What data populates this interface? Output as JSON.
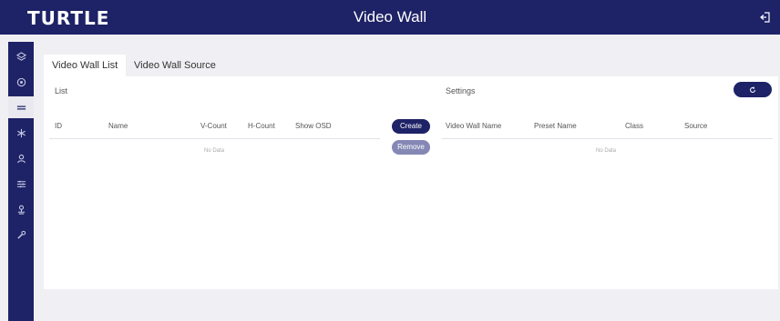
{
  "header": {
    "logo": "TURTLE",
    "title": "Video Wall"
  },
  "sidebar": {
    "items": [
      {
        "icon": "stack-icon"
      },
      {
        "icon": "target-icon"
      },
      {
        "icon": "grid-icon",
        "active": true
      },
      {
        "icon": "network-icon"
      },
      {
        "icon": "user-icon"
      },
      {
        "icon": "sliders-icon"
      },
      {
        "icon": "admin-icon"
      },
      {
        "icon": "wrench-icon"
      }
    ]
  },
  "tabs": [
    {
      "label": "Video Wall List",
      "active": true
    },
    {
      "label": "Video Wall Source",
      "active": false
    }
  ],
  "list": {
    "label": "List",
    "columns": [
      "ID",
      "Name",
      "V-Count",
      "H-Count",
      "Show OSD"
    ],
    "empty_text": "No Data"
  },
  "actions": {
    "create": "Create",
    "remove": "Remove"
  },
  "settings": {
    "label": "Settings",
    "columns": [
      "Video Wall Name",
      "Preset Name",
      "Class",
      "Source"
    ],
    "empty_text": "No Data"
  },
  "colors": {
    "primary": "#1e2266",
    "secondary_button": "#8588b5",
    "background": "#f0f0f4"
  }
}
